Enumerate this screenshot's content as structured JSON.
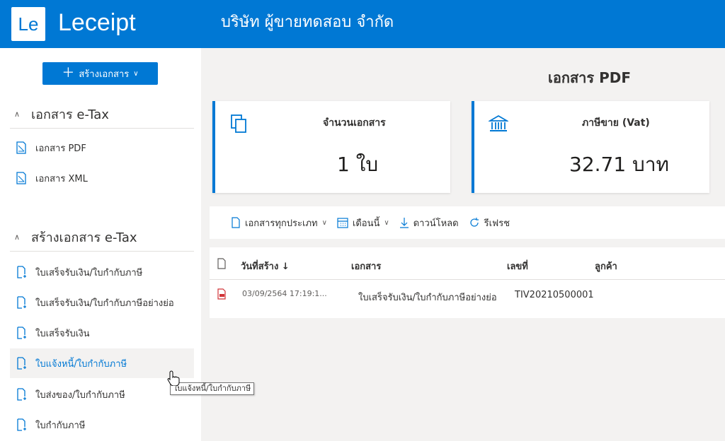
{
  "header": {
    "logo_text": "Le",
    "app_name": "Leceipt",
    "company_name": "บริษัท ผู้ขายทดสอบ จำกัด"
  },
  "sidebar": {
    "create_button_label": "สร้างเอกสาร",
    "groups": [
      {
        "title": "เอกสาร e-Tax",
        "items": [
          {
            "label": "เอกสาร PDF",
            "icon": "pdf-doc-icon"
          },
          {
            "label": "เอกสาร XML",
            "icon": "xml-doc-icon"
          }
        ]
      },
      {
        "title": "สร้างเอกสาร e-Tax",
        "items": [
          {
            "label": "ใบเสร็จรับเงิน/ใบกำกับภาษี",
            "icon": "document-add-icon"
          },
          {
            "label": "ใบเสร็จรับเงิน/ใบกำกับภาษีอย่างย่อ",
            "icon": "document-add-icon"
          },
          {
            "label": "ใบเสร็จรับเงิน",
            "icon": "document-add-icon"
          },
          {
            "label": "ใบแจ้งหนี้/ใบกำกับภาษี",
            "icon": "document-add-icon"
          },
          {
            "label": "ใบส่งของ/ใบกำกับภาษี",
            "icon": "document-add-icon"
          },
          {
            "label": "ใบกำกับภาษี",
            "icon": "document-add-icon"
          }
        ]
      }
    ],
    "hovered_item": "ใบแจ้งหนี้/ใบกำกับภาษี"
  },
  "main": {
    "page_title": "เอกสาร PDF",
    "cards": [
      {
        "label": "จำนวนเอกสาร",
        "value": "1 ใบ",
        "icon": "documents-stack-icon"
      },
      {
        "label": "ภาษีขาย (Vat)",
        "value": "32.71 บาท",
        "icon": "bank-icon"
      }
    ],
    "toolbar": {
      "doc_type_label": "เอกสารทุกประเภท",
      "period_label": "เดือนนี้",
      "download_label": "ดาวน์โหลด",
      "refresh_label": "รีเฟรช"
    },
    "table": {
      "columns": [
        "วันที่สร้าง ↓",
        "เอกสาร",
        "เลขที่",
        "ลูกค้า"
      ],
      "rows": [
        {
          "created": "03/09/2564 17:19:1...",
          "document": "ใบเสร็จรับเงิน/ใบกำกับภาษีอย่างย่อ",
          "number": "TIV20210500001",
          "customer": ""
        }
      ]
    }
  },
  "tooltip": "ใบแจ้งหนี้/ใบกำกับภาษี",
  "colors": {
    "brand": "#0078d4",
    "pdf_red": "#d13438"
  }
}
